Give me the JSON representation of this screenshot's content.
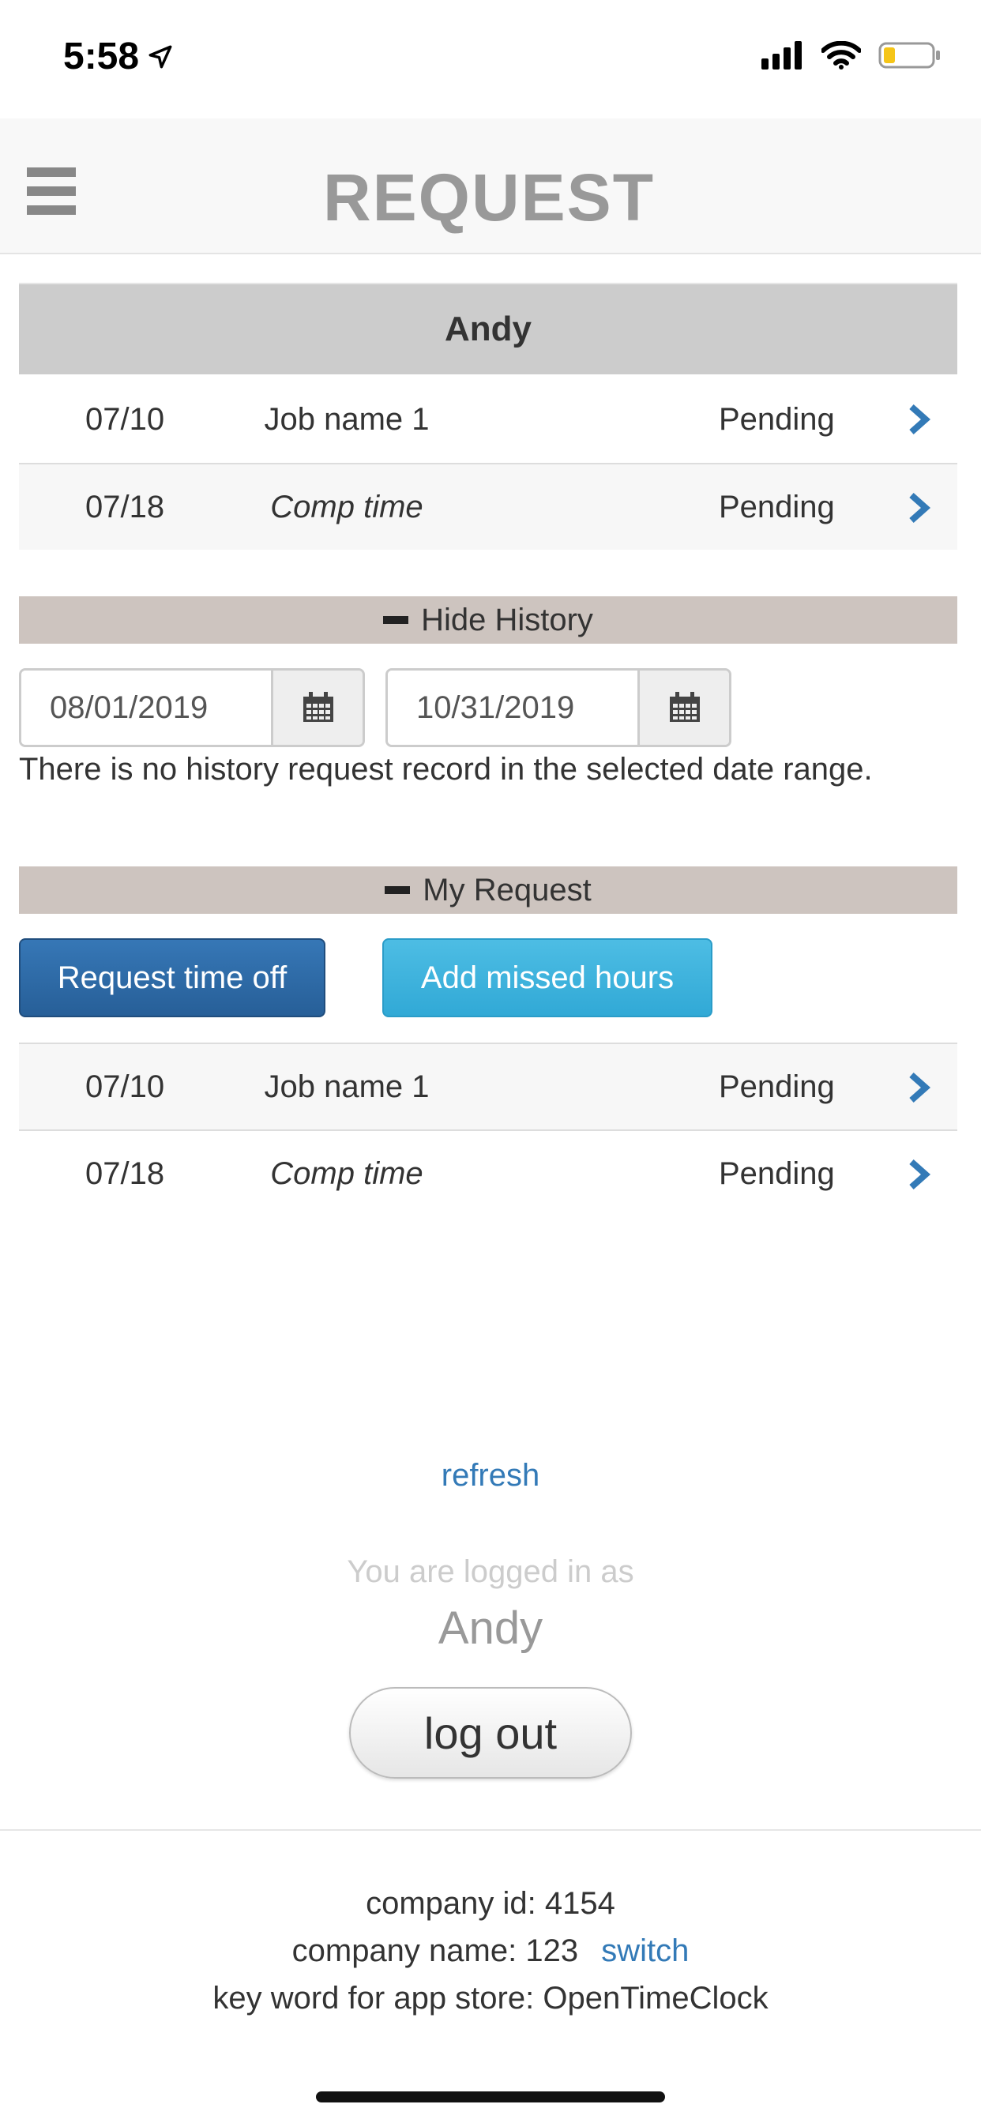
{
  "status_bar": {
    "time": "5:58"
  },
  "navbar": {
    "title": "REQUEST",
    "menu_icon": "hamburger-icon"
  },
  "employee": {
    "name": "Andy",
    "requests": [
      {
        "date": "07/10",
        "job": "Job name 1",
        "status": "Pending"
      },
      {
        "date": "07/18",
        "job": "Comp time",
        "status": "Pending"
      }
    ]
  },
  "history": {
    "toggle_label": "Hide History",
    "start_date": "08/01/2019",
    "end_date": "10/31/2019",
    "empty_message": "There is no history request record in the selected date range."
  },
  "my_request": {
    "toggle_label": "My Request",
    "request_time_off_label": "Request time off",
    "add_missed_hours_label": "Add missed hours",
    "requests": [
      {
        "date": "07/10",
        "job": "Job name 1",
        "status": "Pending"
      },
      {
        "date": "07/18",
        "job": "Comp time",
        "status": "Pending"
      }
    ]
  },
  "session": {
    "refresh_label": "refresh",
    "logged_in_label": "You are logged in as",
    "user_name": "Andy",
    "logout_label": "log out"
  },
  "footer": {
    "company_id_label": "company id:",
    "company_id": "4154",
    "company_name_label": "company name:",
    "company_name": "123",
    "switch_label": "switch",
    "keyword_label": "key word for app store:",
    "keyword": "OpenTimeClock"
  },
  "colors": {
    "primary": "#2c6aa6",
    "info": "#3db3de",
    "link": "#337ab7",
    "section_bar": "#cdc4bf",
    "header_gray": "#cccccc"
  }
}
